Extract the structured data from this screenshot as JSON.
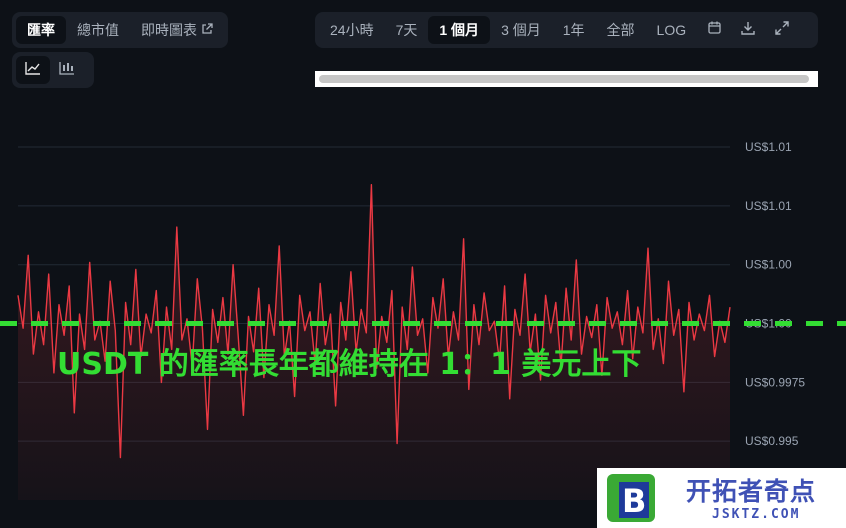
{
  "metric_tabs": [
    {
      "label": "匯率",
      "active": true
    },
    {
      "label": "總市值",
      "active": false
    },
    {
      "label": "即時圖表",
      "active": false,
      "external_icon": "external-link-icon"
    }
  ],
  "chart_type_buttons": [
    {
      "icon": "line-chart-icon",
      "active": true
    },
    {
      "icon": "candlestick-chart-icon",
      "active": false
    }
  ],
  "range_tabs": [
    {
      "label": "24小時",
      "active": false
    },
    {
      "label": "7天",
      "active": false
    },
    {
      "label": "1 個月",
      "active": true
    },
    {
      "label": "3 個月",
      "active": false
    },
    {
      "label": "1年",
      "active": false
    },
    {
      "label": "全部",
      "active": false
    },
    {
      "label": "LOG",
      "active": false
    }
  ],
  "toolbar_icons": [
    "calendar-icon",
    "download-icon",
    "fullscreen-icon"
  ],
  "annotation": {
    "text": "USDT 的匯率長年都維持在 1：1 美元上下",
    "color": "#33dd33",
    "line_value": 1.0
  },
  "watermark": {
    "title": "开拓者奇点",
    "subtitle": "JSKTZ.COM",
    "logo_letter": "B"
  },
  "colors": {
    "line": "#ea3943",
    "grid": "#222a35",
    "axis_text": "#9aa4b2",
    "dash": "#33dd33"
  },
  "chart_data": {
    "type": "line",
    "y_tick_labels": [
      "US$1.01",
      "US$1.01",
      "US$1.00",
      "US$1.00",
      "US$0.9975",
      "US$0.995"
    ],
    "y_tick_values": [
      1.0075,
      1.005,
      1.0025,
      1.0,
      0.9975,
      0.995
    ],
    "ylim": [
      0.9925,
      1.0095
    ],
    "grid": true,
    "series": [
      {
        "values": [
          1.0012,
          0.9998,
          1.0029,
          0.9987,
          1.0005,
          0.9991,
          1.0021,
          0.9979,
          1.0008,
          0.9995,
          1.0016,
          0.9962,
          1.0004,
          0.9989,
          1.0026,
          0.9993,
          1.0001,
          0.9984,
          1.0018,
          0.9997,
          0.9943,
          1.0009,
          0.9991,
          1.0023,
          0.9986,
          1.0004,
          0.9996,
          1.0014,
          0.9975,
          1.0007,
          0.9989,
          1.0041,
          0.9993,
          1.0002,
          0.9982,
          1.0019,
          0.9998,
          0.9955,
          1.0006,
          0.9992,
          1.0011,
          0.9987,
          1.0025,
          0.9994,
          0.9961,
          1.0003,
          0.9988,
          1.0015,
          0.9977,
          1.0008,
          0.9995,
          1.0033,
          0.9986,
          1.0001,
          0.9969,
          1.0012,
          0.9997,
          1.0005,
          0.9983,
          1.0017,
          0.9991,
          1.0004,
          0.9965,
          1.0009,
          0.9993,
          1.0022,
          0.9988,
          1.0006,
          0.9996,
          1.0059,
          0.9981,
          1.0003,
          0.9992,
          1.0014,
          0.9949,
          1.0007,
          0.9989,
          1.0024,
          0.9995,
          1.0002,
          0.9979,
          1.0011,
          0.9998,
          1.0019,
          0.9986,
          1.0005,
          0.9993,
          1.0036,
          0.9972,
          1.0008,
          0.9991,
          1.0013,
          0.9997,
          1.0001,
          0.9984,
          1.0016,
          0.9968,
          1.0006,
          0.9995,
          1.0021,
          0.9988,
          1.0004,
          0.9976,
          1.0012,
          0.9996,
          1.0009,
          0.9982,
          1.0015,
          0.9993,
          1.0027,
          0.9987,
          1.0003,
          0.9994,
          1.0008,
          0.9978,
          1.0011,
          0.9998,
          1.0005,
          0.9991,
          1.0014,
          0.9985,
          1.0007,
          0.9996,
          1.0032,
          0.9989,
          1.0002,
          0.9983,
          1.0018,
          0.9995,
          1.0006,
          0.9971,
          1.0009,
          0.9993,
          1.0004,
          0.9997,
          1.0012,
          0.9986,
          1.0001,
          0.9992,
          1.0007
        ]
      }
    ]
  }
}
